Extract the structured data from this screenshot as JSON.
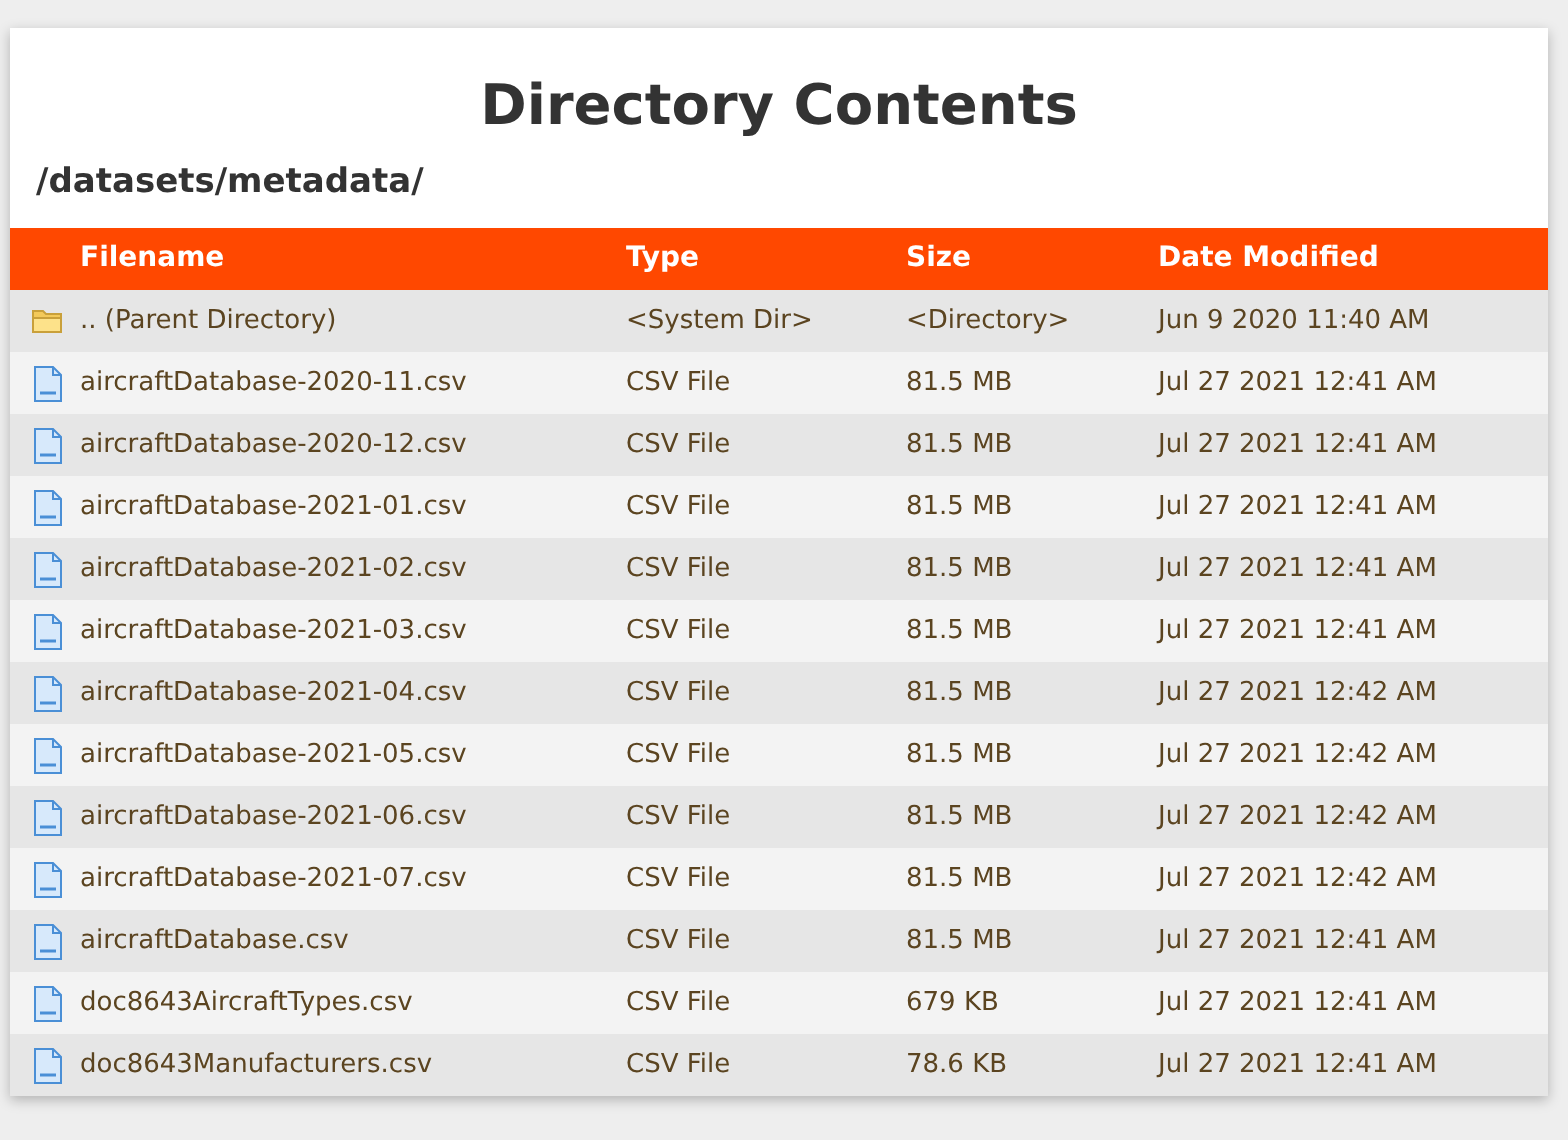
{
  "title": "Directory Contents",
  "path": "/datasets/metadata/",
  "table": {
    "columns": [
      "Filename",
      "Type",
      "Size",
      "Date Modified"
    ],
    "rows": [
      {
        "kind": "folder",
        "name": ".. (Parent Directory)",
        "type": "<System Dir>",
        "size": "<Directory>",
        "date": "Jun 9 2020 11:40 AM"
      },
      {
        "kind": "file",
        "name": "aircraftDatabase-2020-11.csv",
        "type": "CSV File",
        "size": "81.5 MB",
        "date": "Jul 27 2021 12:41 AM"
      },
      {
        "kind": "file",
        "name": "aircraftDatabase-2020-12.csv",
        "type": "CSV File",
        "size": "81.5 MB",
        "date": "Jul 27 2021 12:41 AM"
      },
      {
        "kind": "file",
        "name": "aircraftDatabase-2021-01.csv",
        "type": "CSV File",
        "size": "81.5 MB",
        "date": "Jul 27 2021 12:41 AM"
      },
      {
        "kind": "file",
        "name": "aircraftDatabase-2021-02.csv",
        "type": "CSV File",
        "size": "81.5 MB",
        "date": "Jul 27 2021 12:41 AM"
      },
      {
        "kind": "file",
        "name": "aircraftDatabase-2021-03.csv",
        "type": "CSV File",
        "size": "81.5 MB",
        "date": "Jul 27 2021 12:41 AM"
      },
      {
        "kind": "file",
        "name": "aircraftDatabase-2021-04.csv",
        "type": "CSV File",
        "size": "81.5 MB",
        "date": "Jul 27 2021 12:42 AM"
      },
      {
        "kind": "file",
        "name": "aircraftDatabase-2021-05.csv",
        "type": "CSV File",
        "size": "81.5 MB",
        "date": "Jul 27 2021 12:42 AM"
      },
      {
        "kind": "file",
        "name": "aircraftDatabase-2021-06.csv",
        "type": "CSV File",
        "size": "81.5 MB",
        "date": "Jul 27 2021 12:42 AM"
      },
      {
        "kind": "file",
        "name": "aircraftDatabase-2021-07.csv",
        "type": "CSV File",
        "size": "81.5 MB",
        "date": "Jul 27 2021 12:42 AM"
      },
      {
        "kind": "file",
        "name": "aircraftDatabase.csv",
        "type": "CSV File",
        "size": "81.5 MB",
        "date": "Jul 27 2021 12:41 AM"
      },
      {
        "kind": "file",
        "name": "doc8643AircraftTypes.csv",
        "type": "CSV File",
        "size": "679 KB",
        "date": "Jul 27 2021 12:41 AM"
      },
      {
        "kind": "file",
        "name": "doc8643Manufacturers.csv",
        "type": "CSV File",
        "size": "78.6 KB",
        "date": "Jul 27 2021 12:41 AM"
      }
    ]
  }
}
